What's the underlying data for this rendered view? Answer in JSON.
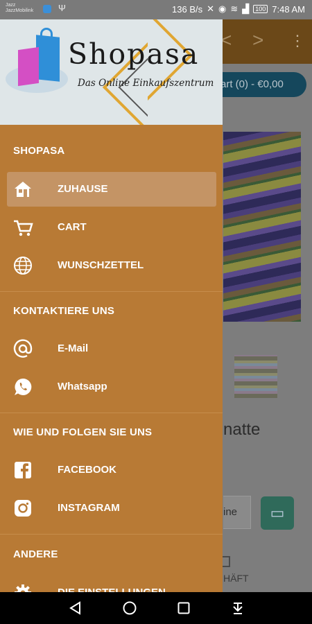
{
  "status_bar": {
    "carrier_line1": "Jazz",
    "carrier_line2": "JazzMobilink",
    "network_speed": "136 B/s",
    "battery": "100",
    "time": "7:48 AM"
  },
  "background_app": {
    "cart_label": "art (0) - €0,00",
    "title_fragment": "natte",
    "online_fragment": "ine",
    "geschaeft_fragment": "HÄFT"
  },
  "drawer": {
    "logo_title": "Shopasa",
    "logo_subtitle": "Das Online Einkaufszentrum",
    "sections": [
      {
        "heading": "SHOPASA",
        "items": [
          {
            "label": "ZUHAUSE",
            "icon": "home-icon",
            "active": true
          },
          {
            "label": "CART",
            "icon": "cart-icon",
            "active": false
          },
          {
            "label": "WUNSCHZETTEL",
            "icon": "globe-icon",
            "active": false
          }
        ]
      },
      {
        "heading": "KONTAKTIERE UNS",
        "items": [
          {
            "label": "E-Mail",
            "icon": "at-icon",
            "active": false
          },
          {
            "label": "Whatsapp",
            "icon": "whatsapp-icon",
            "active": false
          }
        ]
      },
      {
        "heading": "WIE UND FOLGEN SIE UNS",
        "items": [
          {
            "label": "FACEBOOK",
            "icon": "facebook-icon",
            "active": false
          },
          {
            "label": "INSTAGRAM",
            "icon": "instagram-icon",
            "active": false
          }
        ]
      },
      {
        "heading": "ANDERE",
        "items": [
          {
            "label": "DIE EINSTELLUNGEN",
            "icon": "gear-icon",
            "active": false
          }
        ]
      }
    ]
  },
  "colors": {
    "drawer_bg": "#b87a35",
    "active_item_bg": "#c49465",
    "header_bg": "#dfe6e8",
    "logo_accent": "#e0a632"
  },
  "nav_bar": {
    "icons": [
      "back-icon",
      "home-circle-icon",
      "recents-square-icon",
      "notification-pull-icon"
    ]
  }
}
